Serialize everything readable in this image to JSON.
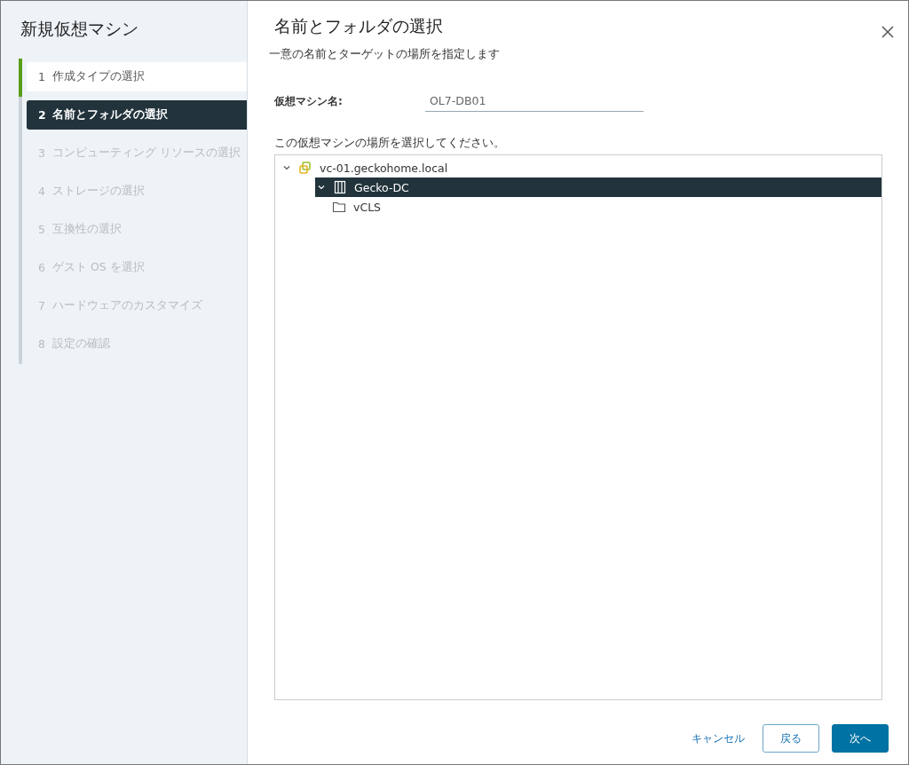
{
  "wizard": {
    "title": "新規仮想マシン",
    "steps": [
      {
        "number": "1",
        "label": "作成タイプの選択",
        "completed": true,
        "selected": false,
        "disabled": false
      },
      {
        "number": "2",
        "label": "名前とフォルダの選択",
        "completed": false,
        "selected": true,
        "disabled": false
      },
      {
        "number": "3",
        "label": "コンピューティング リソースの選択",
        "completed": false,
        "selected": false,
        "disabled": true
      },
      {
        "number": "4",
        "label": "ストレージの選択",
        "completed": false,
        "selected": false,
        "disabled": true
      },
      {
        "number": "5",
        "label": "互換性の選択",
        "completed": false,
        "selected": false,
        "disabled": true
      },
      {
        "number": "6",
        "label": "ゲスト OS を選択",
        "completed": false,
        "selected": false,
        "disabled": true
      },
      {
        "number": "7",
        "label": "ハードウェアのカスタマイズ",
        "completed": false,
        "selected": false,
        "disabled": true
      },
      {
        "number": "8",
        "label": "設定の確認",
        "completed": false,
        "selected": false,
        "disabled": true
      }
    ]
  },
  "page": {
    "title": "名前とフォルダの選択",
    "subtitle": "一意の名前とターゲットの場所を指定します",
    "name_field": {
      "label": "仮想マシン名:",
      "value": "OL7-DB01"
    },
    "location_label": "この仮想マシンの場所を選択してください。",
    "tree": [
      {
        "kind": "vcenter",
        "label": "vc-01.geckohome.local",
        "expanded": true,
        "selected": false,
        "children": [
          {
            "kind": "datacenter",
            "label": "Gecko-DC",
            "expanded": true,
            "selected": true,
            "children": [
              {
                "kind": "folder",
                "label": "vCLS",
                "selected": false
              }
            ]
          }
        ]
      }
    ]
  },
  "buttons": [
    {
      "kind": "link",
      "label": "キャンセル"
    },
    {
      "kind": "outline",
      "label": "戻る"
    },
    {
      "kind": "primary",
      "label": "次へ"
    }
  ]
}
